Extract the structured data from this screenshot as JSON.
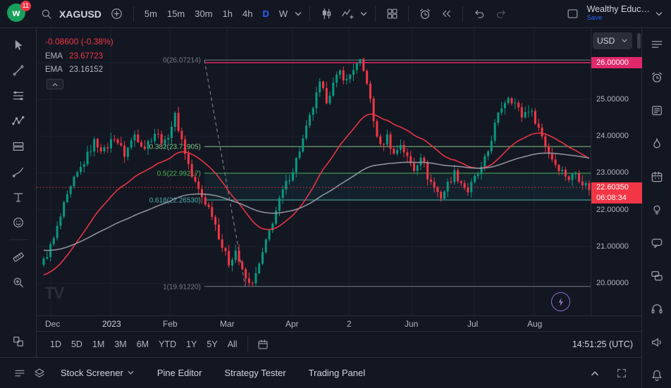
{
  "topbar": {
    "logo_badge": "11",
    "symbol": "XAGUSD",
    "timeframes": [
      "5m",
      "15m",
      "30m",
      "1h",
      "4h",
      "D",
      "W"
    ],
    "active_timeframe": "D",
    "layout_name": "Wealthy Educ…",
    "save_label": "Save"
  },
  "legend": {
    "change": "-0.08600 (-0.38%)",
    "ema1_label": "EMA",
    "ema1_value": "23.67723",
    "ema2_label": "EMA",
    "ema2_value": "23.16152"
  },
  "price_scale": {
    "currency": "USD",
    "top_badge": "26.00000",
    "ticks": [
      "25.00000",
      "24.00000",
      "23.00000",
      "22.00000",
      "21.00000",
      "20.00000"
    ],
    "current_value": "22.60350",
    "current_countdown": "06:08:34"
  },
  "time_axis": {
    "labels": [
      "Dec",
      "2023",
      "Feb",
      "Mar",
      "Apr",
      "2",
      "Jun",
      "Jul",
      "Aug"
    ]
  },
  "range_bar": {
    "ranges": [
      "1D",
      "5D",
      "1M",
      "3M",
      "6M",
      "YTD",
      "1Y",
      "5Y",
      "All"
    ],
    "clock": "14:51:25 (UTC)"
  },
  "bottom_panel": {
    "tabs": [
      "Stock Screener",
      "Pine Editor",
      "Strategy Tester",
      "Trading Panel"
    ]
  },
  "chart_data": {
    "type": "candlestick",
    "symbol": "XAGUSD",
    "interval": "1D",
    "colors": {
      "up": "#089981",
      "down": "#f23645",
      "grid": "#1b2030",
      "current_line": "#f23645",
      "alert_line": "#e0286b"
    },
    "y_ticks": [
      26,
      25,
      24,
      23,
      22,
      21,
      20
    ],
    "x_labels": [
      "Dec",
      "2023",
      "Feb",
      "Mar",
      "Apr",
      "2",
      "Jun",
      "Jul",
      "Aug"
    ],
    "current_price": 22.6035,
    "change": "-0.08600 (-0.38%)",
    "horizontal_line": 26.0,
    "fib_levels": [
      {
        "label": "0(26.07214)",
        "price": 26.07214,
        "color": "#787b86"
      },
      {
        "label": "0.382(23.71905)",
        "price": 23.71905,
        "color": "#81c784"
      },
      {
        "label": "0.5(22.99217)",
        "price": 22.99217,
        "color": "#4caf50"
      },
      {
        "label": "0.618(22.26530)",
        "price": 22.2653,
        "color": "#4db6ac"
      },
      {
        "label": "1(19.91220)",
        "price": 19.9122,
        "color": "#787b86"
      }
    ],
    "fib_band": {
      "from_price": 22.99217,
      "to_price": 22.2653,
      "fill": "rgba(38,198,218,0.06)"
    },
    "fib_trend": {
      "from_price": 26.07214,
      "to_price": 19.9122
    },
    "extremes": {
      "high_index": 94,
      "high": 26.072,
      "low_index": 61,
      "low": 19.912
    },
    "num_candles": 163,
    "waypoints": [
      [
        0,
        20.6
      ],
      [
        3,
        21.2
      ],
      [
        6,
        22.1
      ],
      [
        9,
        22.8
      ],
      [
        12,
        23.3
      ],
      [
        15,
        23.85
      ],
      [
        18,
        23.6
      ],
      [
        21,
        24.0
      ],
      [
        24,
        23.5
      ],
      [
        27,
        24.05
      ],
      [
        30,
        23.7
      ],
      [
        33,
        24.1
      ],
      [
        36,
        23.8
      ],
      [
        39,
        24.55
      ],
      [
        41,
        23.9
      ],
      [
        44,
        22.9
      ],
      [
        47,
        22.35
      ],
      [
        50,
        21.9
      ],
      [
        53,
        21.0
      ],
      [
        55,
        20.55
      ],
      [
        57,
        20.9
      ],
      [
        59,
        20.3
      ],
      [
        61,
        19.95
      ],
      [
        63,
        20.2
      ],
      [
        65,
        20.8
      ],
      [
        68,
        21.7
      ],
      [
        71,
        22.5
      ],
      [
        74,
        23.1
      ],
      [
        77,
        23.9
      ],
      [
        80,
        24.8
      ],
      [
        82,
        25.4
      ],
      [
        84,
        25.0
      ],
      [
        86,
        25.4
      ],
      [
        88,
        25.75
      ],
      [
        90,
        25.5
      ],
      [
        92,
        25.85
      ],
      [
        94,
        26.0
      ],
      [
        96,
        25.5
      ],
      [
        98,
        24.4
      ],
      [
        100,
        23.7
      ],
      [
        102,
        24.0
      ],
      [
        104,
        23.5
      ],
      [
        106,
        23.8
      ],
      [
        108,
        23.4
      ],
      [
        110,
        23.1
      ],
      [
        112,
        23.5
      ],
      [
        114,
        22.9
      ],
      [
        116,
        22.6
      ],
      [
        118,
        22.35
      ],
      [
        120,
        22.7
      ],
      [
        122,
        23.0
      ],
      [
        124,
        22.75
      ],
      [
        126,
        22.5
      ],
      [
        128,
        22.85
      ],
      [
        130,
        23.1
      ],
      [
        132,
        23.6
      ],
      [
        134,
        24.3
      ],
      [
        136,
        24.8
      ],
      [
        138,
        25.1
      ],
      [
        140,
        24.9
      ],
      [
        142,
        24.55
      ],
      [
        144,
        24.75
      ],
      [
        146,
        24.45
      ],
      [
        148,
        24.0
      ],
      [
        150,
        23.55
      ],
      [
        152,
        23.25
      ],
      [
        154,
        23.05
      ],
      [
        156,
        22.85
      ],
      [
        158,
        23.0
      ],
      [
        160,
        22.75
      ],
      [
        162,
        22.6
      ]
    ],
    "emas": [
      {
        "label": "EMA",
        "period": 30,
        "seed": 20.2,
        "value": 23.67723,
        "color": "#f23645"
      },
      {
        "label": "EMA",
        "period": 100,
        "seed": 20.9,
        "value": 23.16152,
        "color": "#9598a1"
      }
    ]
  }
}
